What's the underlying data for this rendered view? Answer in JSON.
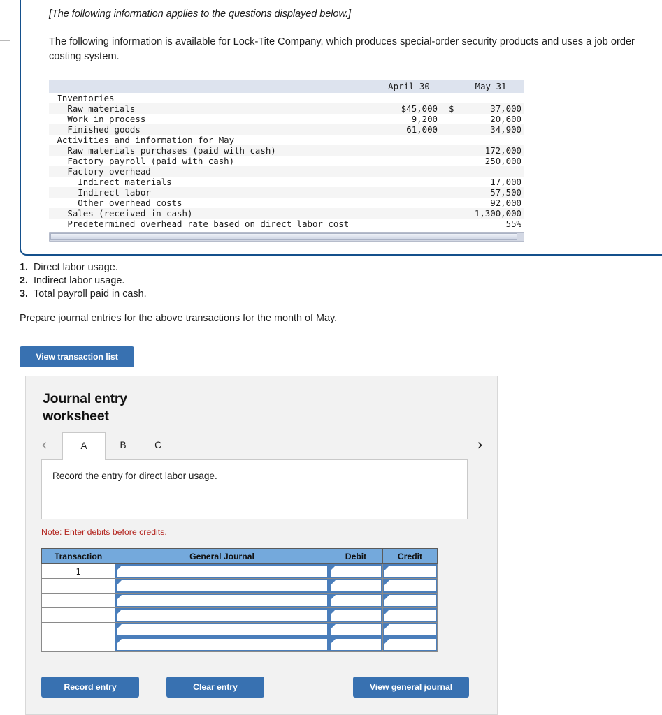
{
  "info": {
    "lead_italic": "[The following information applies to the questions displayed below.]",
    "paragraph": "The following information is available for Lock-Tite Company, which produces special-order security products and uses a job order costing system."
  },
  "fin_table": {
    "col_headers": [
      "",
      "April 30",
      "",
      "May 31"
    ],
    "rows": [
      {
        "label": " Inventories",
        "april": "",
        "cur": "",
        "may": "",
        "shade": false
      },
      {
        "label": "   Raw materials",
        "april": "$45,000",
        "cur": "$",
        "may": "37,000",
        "shade": true
      },
      {
        "label": "   Work in process",
        "april": "9,200",
        "cur": "",
        "may": "20,600",
        "shade": false
      },
      {
        "label": "   Finished goods",
        "april": "61,000",
        "cur": "",
        "may": "34,900",
        "shade": true
      },
      {
        "label": " Activities and information for May",
        "april": "",
        "cur": "",
        "may": "",
        "shade": false
      },
      {
        "label": "   Raw materials purchases (paid with cash)",
        "april": "",
        "cur": "",
        "may": "172,000",
        "shade": true
      },
      {
        "label": "   Factory payroll (paid with cash)",
        "april": "",
        "cur": "",
        "may": "250,000",
        "shade": false
      },
      {
        "label": "   Factory overhead",
        "april": "",
        "cur": "",
        "may": "",
        "shade": true
      },
      {
        "label": "     Indirect materials",
        "april": "",
        "cur": "",
        "may": "17,000",
        "shade": false
      },
      {
        "label": "     Indirect labor",
        "april": "",
        "cur": "",
        "may": "57,500",
        "shade": true
      },
      {
        "label": "     Other overhead costs",
        "april": "",
        "cur": "",
        "may": "92,000",
        "shade": false
      },
      {
        "label": "   Sales (received in cash)",
        "april": "",
        "cur": "",
        "may": "1,300,000",
        "shade": true
      },
      {
        "label": "   Predetermined overhead rate based on direct labor cost",
        "april": "",
        "cur": "",
        "may": "55%",
        "shade": false
      }
    ]
  },
  "questions": [
    {
      "num": "1.",
      "text": "Direct labor usage."
    },
    {
      "num": "2.",
      "text": "Indirect labor usage."
    },
    {
      "num": "3.",
      "text": "Total payroll paid in cash."
    }
  ],
  "prepare_text": "Prepare journal entries for the above transactions for the month of May.",
  "view_transaction_list_label": "View transaction list",
  "worksheet": {
    "title": "Journal entry worksheet",
    "nav": {
      "prev_icon": "‹",
      "next_icon": "›"
    },
    "tabs": [
      {
        "label": "A",
        "active": true
      },
      {
        "label": "B",
        "active": false
      },
      {
        "label": "C",
        "active": false
      }
    ],
    "instruction": "Record the entry for direct labor usage.",
    "note": "Note: Enter debits before credits.",
    "table": {
      "headers": [
        "Transaction",
        "General Journal",
        "Debit",
        "Credit"
      ],
      "rows": [
        {
          "transaction": "1",
          "general_journal": "",
          "debit": "",
          "credit": ""
        },
        {
          "transaction": "",
          "general_journal": "",
          "debit": "",
          "credit": ""
        },
        {
          "transaction": "",
          "general_journal": "",
          "debit": "",
          "credit": ""
        },
        {
          "transaction": "",
          "general_journal": "",
          "debit": "",
          "credit": ""
        },
        {
          "transaction": "",
          "general_journal": "",
          "debit": "",
          "credit": ""
        },
        {
          "transaction": "",
          "general_journal": "",
          "debit": "",
          "credit": ""
        }
      ]
    },
    "buttons": {
      "record": "Record entry",
      "clear": "Clear entry",
      "view_gj": "View general journal"
    }
  },
  "colors": {
    "accent_blue": "#3871b1",
    "header_blue": "#74a9dc",
    "border_blue": "#14508c",
    "input_border": "#4a7ebb",
    "note_red": "#b3251f"
  }
}
